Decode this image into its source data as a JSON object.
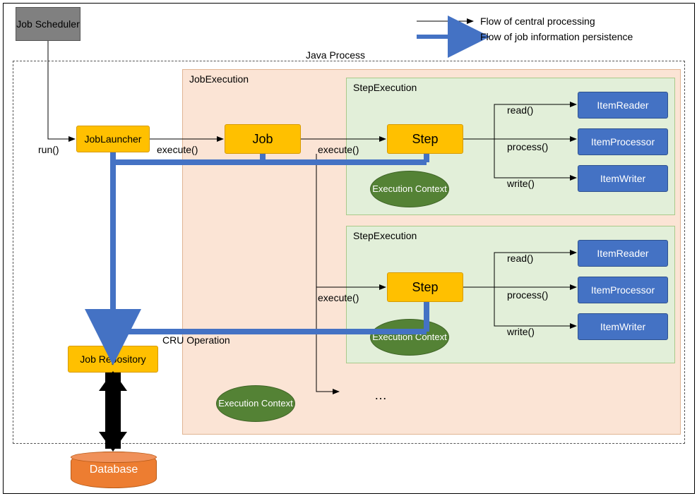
{
  "legend": {
    "central": "Flow of central processing",
    "persistence": "Flow of job information persistence"
  },
  "containers": {
    "javaProcess": "Java Process",
    "jobExecution": "JobExecution",
    "stepExecution": "StepExecution"
  },
  "boxes": {
    "jobScheduler": "Job Scheduler",
    "jobLauncher": "JobLauncher",
    "job": "Job",
    "step": "Step",
    "jobRepository": "Job Repository",
    "database": "Database",
    "itemReader": "ItemReader",
    "itemProcessor": "ItemProcessor",
    "itemWriter": "ItemWriter",
    "executionContext": "Execution Context"
  },
  "labels": {
    "run": "run()",
    "execute": "execute()",
    "read": "read()",
    "process": "process()",
    "write": "write()",
    "cruOperation": "CRU Operation",
    "ellipsis": "…"
  }
}
